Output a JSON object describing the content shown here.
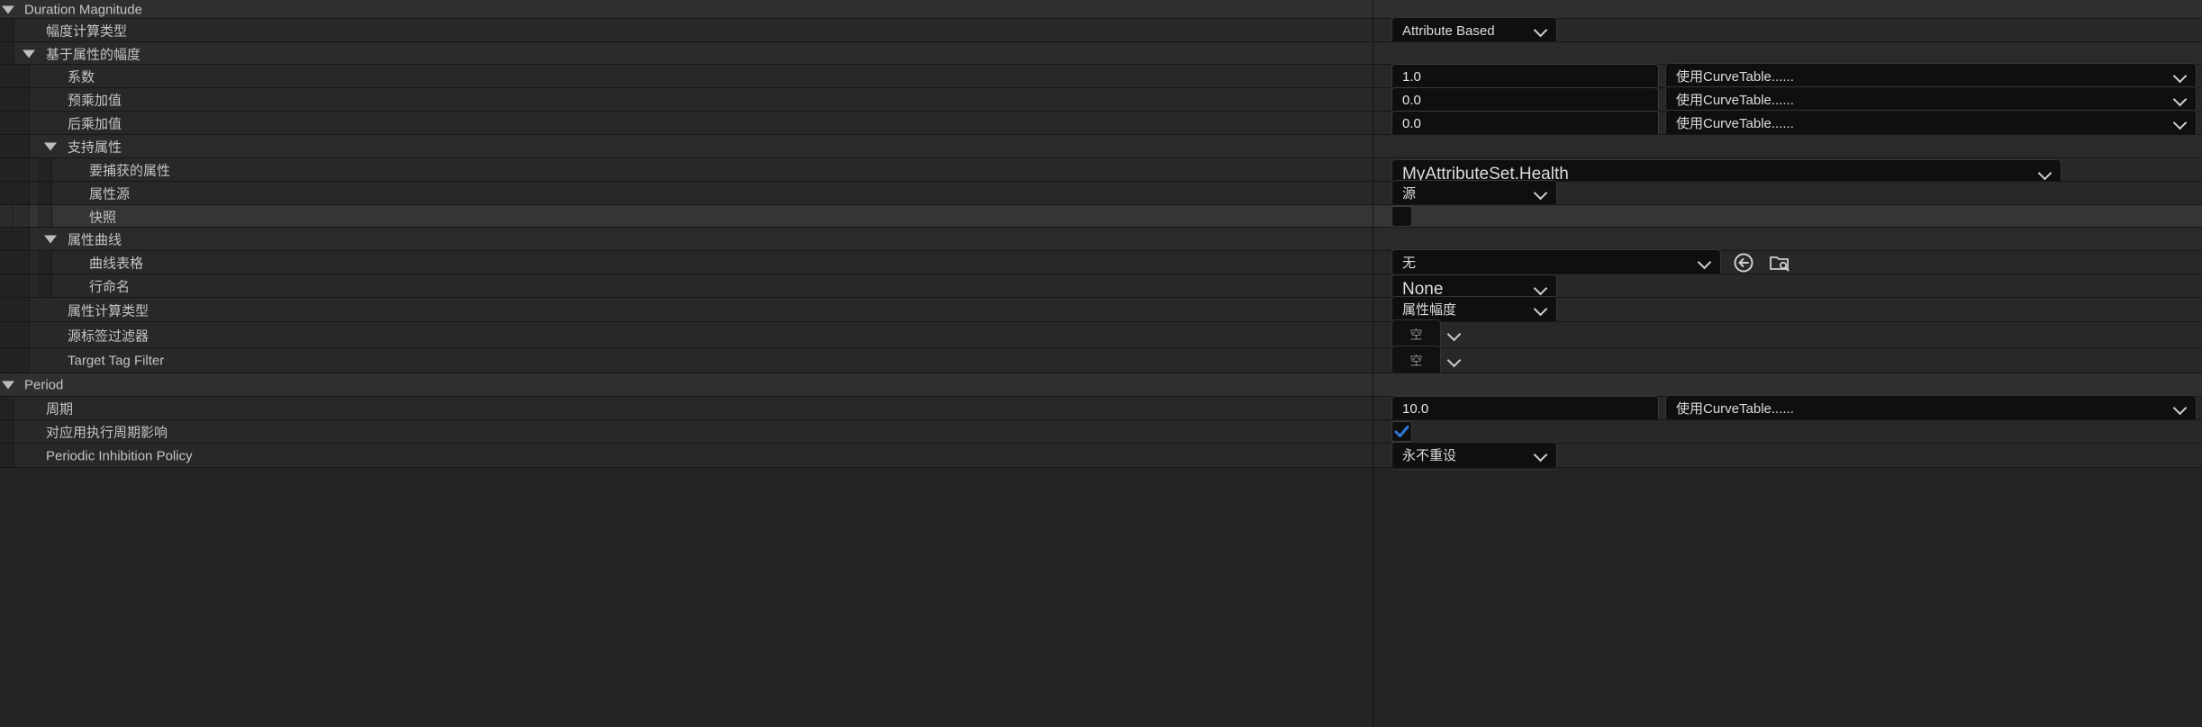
{
  "duration_magnitude": {
    "header": "Duration Magnitude",
    "calc_type_label": "幅度计算类型",
    "calc_type_value": "Attribute Based",
    "attr_based_group": "基于属性的幅度",
    "coefficient_label": "系数",
    "coefficient_value": "1.0",
    "coefficient_curve": "使用CurveTable......",
    "pre_add_label": "预乘加值",
    "pre_add_value": "0.0",
    "pre_add_curve": "使用CurveTable......",
    "post_add_label": "后乘加值",
    "post_add_value": "0.0",
    "post_add_curve": "使用CurveTable......",
    "backing_group": "支持属性",
    "capture_attr_label": "要捕获的属性",
    "capture_attr_value": "MyAttributeSet.Health",
    "attr_source_label": "属性源",
    "attr_source_value": "源",
    "snapshot_label": "快照",
    "snapshot_checked": false,
    "curve_group": "属性曲线",
    "curve_table_label": "曲线表格",
    "curve_table_value": "无",
    "row_name_label": "行命名",
    "row_name_value": "None",
    "attr_calc_type_label": "属性计算类型",
    "attr_calc_type_value": "属性幅度",
    "source_tag_filter_label": "源标签过滤器",
    "source_tag_filter_value": "空",
    "target_tag_filter_label": "Target Tag Filter",
    "target_tag_filter_value": "空"
  },
  "period": {
    "header": "Period",
    "period_label": "周期",
    "period_value": "10.0",
    "period_curve": "使用CurveTable......",
    "exec_period_label": "对应用执行周期影响",
    "exec_period_checked": true,
    "inhibition_label": "Periodic Inhibition Policy",
    "inhibition_value": "永不重设"
  },
  "colors": {
    "check_accent": "#2f7ad8"
  }
}
